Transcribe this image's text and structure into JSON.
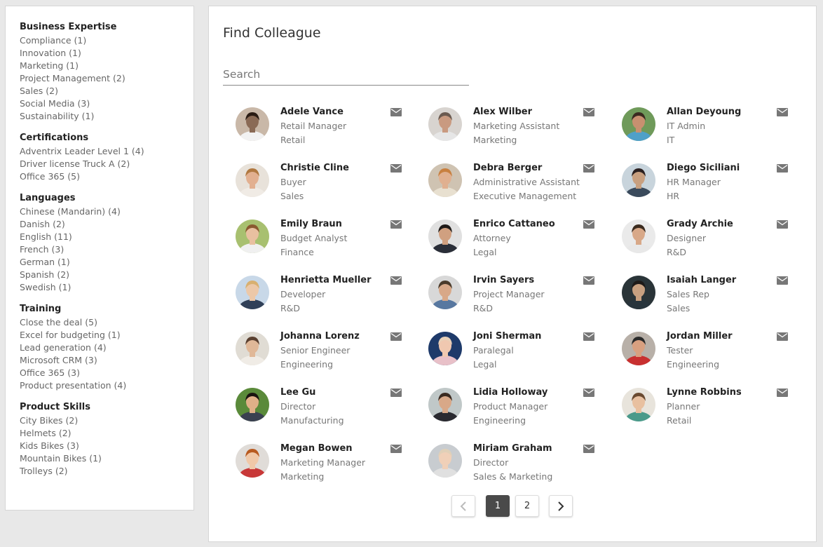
{
  "sidebar": {
    "facets": [
      {
        "title": "Business Expertise",
        "items": [
          "Compliance (1)",
          "Innovation (1)",
          "Marketing (1)",
          "Project Management (2)",
          "Sales (2)",
          "Social Media (3)",
          "Sustainability (1)"
        ]
      },
      {
        "title": "Certifications",
        "items": [
          "Adventrix Leader Level 1 (4)",
          "Driver license Truck A (2)",
          "Office 365 (5)"
        ]
      },
      {
        "title": "Languages",
        "items": [
          "Chinese (Mandarin) (4)",
          "Danish (2)",
          "English (11)",
          "French (3)",
          "German (1)",
          "Spanish (2)",
          "Swedish (1)"
        ]
      },
      {
        "title": "Training",
        "items": [
          "Close the deal (5)",
          "Excel for budgeting (1)",
          "Lead generation (4)",
          "Microsoft CRM (3)",
          "Office 365 (3)",
          "Product presentation (4)"
        ]
      },
      {
        "title": "Product Skills",
        "items": [
          "City Bikes (2)",
          "Helmets (2)",
          "Kids Bikes (3)",
          "Mountain Bikes (1)",
          "Trolleys (2)"
        ]
      }
    ]
  },
  "main": {
    "title": "Find Colleague",
    "search": {
      "placeholder": "Search",
      "value": ""
    },
    "people": [
      {
        "name": "Adele Vance",
        "role": "Retail Manager",
        "dept": "Retail",
        "bg": "#c9b8a8",
        "skin": "#8a6a55",
        "hair": "#2a1c14",
        "shirt": "#f2f2f2"
      },
      {
        "name": "Alex Wilber",
        "role": "Marketing Assistant",
        "dept": "Marketing",
        "bg": "#d8d4d0",
        "skin": "#c99a80",
        "hair": "#6a5a50",
        "shirt": "#e6e6e6"
      },
      {
        "name": "Allan Deyoung",
        "role": "IT Admin",
        "dept": "IT",
        "bg": "#6f9a5a",
        "skin": "#c89070",
        "hair": "#3a2a20",
        "shirt": "#4fa0c8"
      },
      {
        "name": "Christie Cline",
        "role": "Buyer",
        "dept": "Sales",
        "bg": "#e8e2da",
        "skin": "#e2b090",
        "hair": "#b07840",
        "shirt": "#f0ebe5"
      },
      {
        "name": "Debra Berger",
        "role": "Administrative Assistant",
        "dept": "Executive Management",
        "bg": "#cfc3b2",
        "skin": "#e0b090",
        "hair": "#c88040",
        "shirt": "#e8e0d0"
      },
      {
        "name": "Diego Siciliani",
        "role": "HR Manager",
        "dept": "HR",
        "bg": "#c8d4dc",
        "skin": "#c8a080",
        "hair": "#2a2020",
        "shirt": "#3a4a5c"
      },
      {
        "name": "Emily Braun",
        "role": "Budget Analyst",
        "dept": "Finance",
        "bg": "#a8c070",
        "skin": "#e8c0a0",
        "hair": "#8a5a30",
        "shirt": "#f0f0f0"
      },
      {
        "name": "Enrico Cattaneo",
        "role": "Attorney",
        "dept": "Legal",
        "bg": "#e0e0e0",
        "skin": "#d0a080",
        "hair": "#1e1a18",
        "shirt": "#2a2e38"
      },
      {
        "name": "Grady Archie",
        "role": "Designer",
        "dept": "R&D",
        "bg": "#eaeaea",
        "skin": "#d8a888",
        "hair": "#3a2a1e",
        "shirt": "#e8e8e8"
      },
      {
        "name": "Henrietta Mueller",
        "role": "Developer",
        "dept": "R&D",
        "bg": "#c8d8e8",
        "skin": "#ecc8a8",
        "hair": "#d8b070",
        "shirt": "#304058"
      },
      {
        "name": "Irvin Sayers",
        "role": "Project Manager",
        "dept": "R&D",
        "bg": "#d8d8d8",
        "skin": "#d8a888",
        "hair": "#4a3a2a",
        "shirt": "#5878a0"
      },
      {
        "name": "Isaiah Langer",
        "role": "Sales Rep",
        "dept": "Sales",
        "bg": "#2a3438",
        "skin": "#c8a080",
        "hair": "#1e1a18",
        "shirt": "#28343c"
      },
      {
        "name": "Johanna Lorenz",
        "role": "Senior Engineer",
        "dept": "Engineering",
        "bg": "#e0dcd4",
        "skin": "#e0b898",
        "hair": "#5a4030",
        "shirt": "#f0ece6"
      },
      {
        "name": "Joni Sherman",
        "role": "Paralegal",
        "dept": "Legal",
        "bg": "#1e3a6a",
        "skin": "#f0c8b0",
        "hair": "#e8d0b8",
        "shirt": "#e8c0c8"
      },
      {
        "name": "Jordan Miller",
        "role": "Tester",
        "dept": "Engineering",
        "bg": "#b8b0a8",
        "skin": "#d8a080",
        "hair": "#2a2a2a",
        "shirt": "#c83030"
      },
      {
        "name": "Lee Gu",
        "role": "Director",
        "dept": "Manufacturing",
        "bg": "#5a8a3a",
        "skin": "#e0b088",
        "hair": "#1a1410",
        "shirt": "#3a4050"
      },
      {
        "name": "Lidia Holloway",
        "role": "Product Manager",
        "dept": "Engineering",
        "bg": "#c0c8c8",
        "skin": "#d8a888",
        "hair": "#3a2a20",
        "shirt": "#2a2a30"
      },
      {
        "name": "Lynne Robbins",
        "role": "Planner",
        "dept": "Retail",
        "bg": "#e8e4dc",
        "skin": "#e8c0a0",
        "hair": "#6a4a30",
        "shirt": "#4a9a8a"
      },
      {
        "name": "Megan Bowen",
        "role": "Marketing Manager",
        "dept": "Marketing",
        "bg": "#e0dcd8",
        "skin": "#f0c8a8",
        "hair": "#b85a20",
        "shirt": "#c83838"
      },
      {
        "name": "Miriam Graham",
        "role": "Director",
        "dept": "Sales & Marketing",
        "bg": "#c8ccd0",
        "skin": "#f0d0b8",
        "hair": "#e0d0b8",
        "shirt": "#e0e0e0"
      }
    ],
    "pagination": {
      "pages": [
        "1",
        "2"
      ],
      "current": "1"
    }
  },
  "colors": {
    "accent_active": "#4a4a4a",
    "mail_icon": "#777777",
    "text_muted": "#777777"
  },
  "icons": {
    "mail": "mail-icon",
    "prev": "chevron-left-icon",
    "next": "chevron-right-icon"
  }
}
